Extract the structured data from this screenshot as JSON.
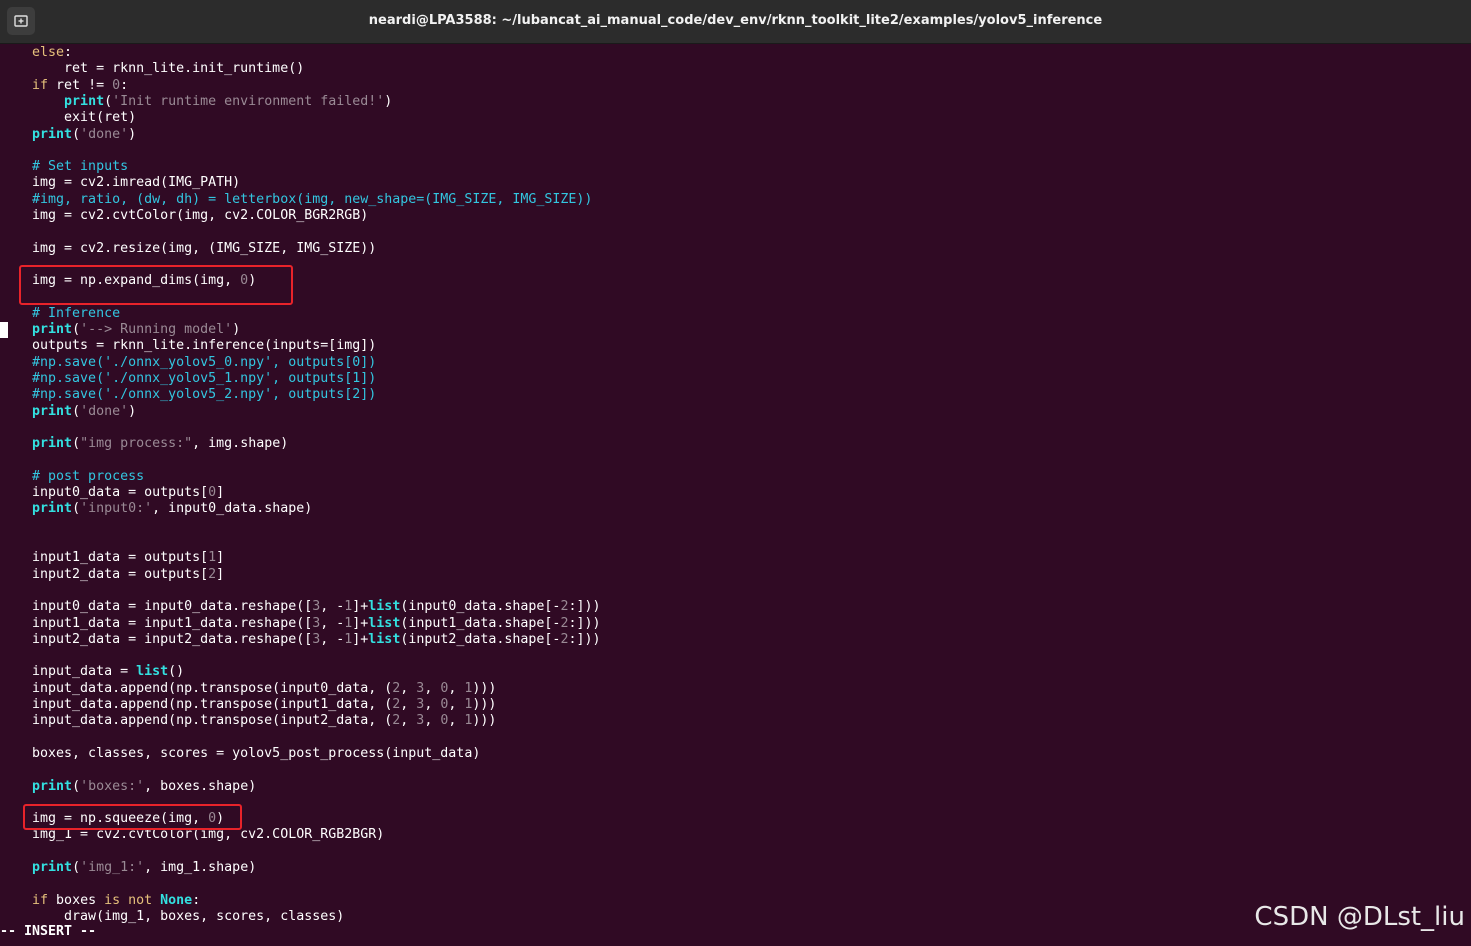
{
  "window": {
    "title": "neardi@LPA3588: ~/lubancat_ai_manual_code/dev_env/rknn_toolkit_lite2/examples/yolov5_inference",
    "new_tab_icon": "new-tab-icon"
  },
  "colors": {
    "background": "#300a24",
    "keyword": "#e5c07b",
    "builtin": "#33e0e0",
    "string": "#9a8a95",
    "comment": "#33c6e0",
    "highlight_box": "#e8232a"
  },
  "editor": {
    "lines": [
      [
        [
          "kw",
          "    else"
        ],
        [
          "tx",
          ":"
        ]
      ],
      [
        [
          "tx",
          "        ret = rknn_lite.init_runtime()"
        ]
      ],
      [
        [
          "kw",
          "    if"
        ],
        [
          "tx",
          " ret != "
        ],
        [
          "num",
          "0"
        ],
        [
          "tx",
          ":"
        ]
      ],
      [
        [
          "tx",
          "        "
        ],
        [
          "bi",
          "print"
        ],
        [
          "tx",
          "("
        ],
        [
          "str",
          "'Init runtime environment failed!'"
        ],
        [
          "tx",
          ")"
        ]
      ],
      [
        [
          "tx",
          "        exit(ret)"
        ]
      ],
      [
        [
          "tx",
          "    "
        ],
        [
          "bi",
          "print"
        ],
        [
          "tx",
          "("
        ],
        [
          "str",
          "'done'"
        ],
        [
          "tx",
          ")"
        ]
      ],
      [],
      [
        [
          "cm",
          "    # Set inputs"
        ]
      ],
      [
        [
          "tx",
          "    img = cv2.imread(IMG_PATH)"
        ]
      ],
      [
        [
          "cm",
          "    #img, ratio, (dw, dh) = letterbox(img, new_shape=(IMG_SIZE, IMG_SIZE))"
        ]
      ],
      [
        [
          "tx",
          "    img = cv2.cvtColor(img, cv2.COLOR_BGR2RGB)"
        ]
      ],
      [],
      [
        [
          "tx",
          "    img = cv2.resize(img, (IMG_SIZE, IMG_SIZE))"
        ]
      ],
      [],
      [
        [
          "tx",
          "    img = np.expand_dims(img, "
        ],
        [
          "num",
          "0"
        ],
        [
          "tx",
          ")"
        ]
      ],
      [],
      [
        [
          "cm",
          "    # Inference"
        ]
      ],
      [
        [
          "tx",
          "    "
        ],
        [
          "bi",
          "print"
        ],
        [
          "tx",
          "("
        ],
        [
          "str",
          "'--> Running model'"
        ],
        [
          "tx",
          ")"
        ]
      ],
      [
        [
          "tx",
          "    outputs = rknn_lite.inference(inputs=[img])"
        ]
      ],
      [
        [
          "cm",
          "    #np.save('./onnx_yolov5_0.npy', outputs[0])"
        ]
      ],
      [
        [
          "cm",
          "    #np.save('./onnx_yolov5_1.npy', outputs[1])"
        ]
      ],
      [
        [
          "cm",
          "    #np.save('./onnx_yolov5_2.npy', outputs[2])"
        ]
      ],
      [
        [
          "tx",
          "    "
        ],
        [
          "bi",
          "print"
        ],
        [
          "tx",
          "("
        ],
        [
          "str",
          "'done'"
        ],
        [
          "tx",
          ")"
        ]
      ],
      [],
      [
        [
          "tx",
          "    "
        ],
        [
          "bi",
          "print"
        ],
        [
          "tx",
          "("
        ],
        [
          "str",
          "\"img process:\""
        ],
        [
          "tx",
          ", img.shape)"
        ]
      ],
      [],
      [
        [
          "cm",
          "    # post process"
        ]
      ],
      [
        [
          "tx",
          "    input0_data = outputs["
        ],
        [
          "num",
          "0"
        ],
        [
          "tx",
          "]"
        ]
      ],
      [
        [
          "tx",
          "    "
        ],
        [
          "bi",
          "print"
        ],
        [
          "tx",
          "("
        ],
        [
          "str",
          "'input0:'"
        ],
        [
          "tx",
          ", input0_data.shape)"
        ]
      ],
      [],
      [],
      [
        [
          "tx",
          "    input1_data = outputs["
        ],
        [
          "num",
          "1"
        ],
        [
          "tx",
          "]"
        ]
      ],
      [
        [
          "tx",
          "    input2_data = outputs["
        ],
        [
          "num",
          "2"
        ],
        [
          "tx",
          "]"
        ]
      ],
      [],
      [
        [
          "tx",
          "    input0_data = input0_data.reshape(["
        ],
        [
          "num",
          "3"
        ],
        [
          "tx",
          ", -"
        ],
        [
          "num",
          "1"
        ],
        [
          "tx",
          "]+"
        ],
        [
          "bi",
          "list"
        ],
        [
          "tx",
          "(input0_data.shape[-"
        ],
        [
          "num",
          "2"
        ],
        [
          "tx",
          ":]))"
        ]
      ],
      [
        [
          "tx",
          "    input1_data = input1_data.reshape(["
        ],
        [
          "num",
          "3"
        ],
        [
          "tx",
          ", -"
        ],
        [
          "num",
          "1"
        ],
        [
          "tx",
          "]+"
        ],
        [
          "bi",
          "list"
        ],
        [
          "tx",
          "(input1_data.shape[-"
        ],
        [
          "num",
          "2"
        ],
        [
          "tx",
          ":]))"
        ]
      ],
      [
        [
          "tx",
          "    input2_data = input2_data.reshape(["
        ],
        [
          "num",
          "3"
        ],
        [
          "tx",
          ", -"
        ],
        [
          "num",
          "1"
        ],
        [
          "tx",
          "]+"
        ],
        [
          "bi",
          "list"
        ],
        [
          "tx",
          "(input2_data.shape[-"
        ],
        [
          "num",
          "2"
        ],
        [
          "tx",
          ":]))"
        ]
      ],
      [],
      [
        [
          "tx",
          "    input_data = "
        ],
        [
          "bi",
          "list"
        ],
        [
          "tx",
          "()"
        ]
      ],
      [
        [
          "tx",
          "    input_data.append(np.transpose(input0_data, ("
        ],
        [
          "num",
          "2"
        ],
        [
          "tx",
          ", "
        ],
        [
          "num",
          "3"
        ],
        [
          "tx",
          ", "
        ],
        [
          "num",
          "0"
        ],
        [
          "tx",
          ", "
        ],
        [
          "num",
          "1"
        ],
        [
          "tx",
          ")))"
        ]
      ],
      [
        [
          "tx",
          "    input_data.append(np.transpose(input1_data, ("
        ],
        [
          "num",
          "2"
        ],
        [
          "tx",
          ", "
        ],
        [
          "num",
          "3"
        ],
        [
          "tx",
          ", "
        ],
        [
          "num",
          "0"
        ],
        [
          "tx",
          ", "
        ],
        [
          "num",
          "1"
        ],
        [
          "tx",
          ")))"
        ]
      ],
      [
        [
          "tx",
          "    input_data.append(np.transpose(input2_data, ("
        ],
        [
          "num",
          "2"
        ],
        [
          "tx",
          ", "
        ],
        [
          "num",
          "3"
        ],
        [
          "tx",
          ", "
        ],
        [
          "num",
          "0"
        ],
        [
          "tx",
          ", "
        ],
        [
          "num",
          "1"
        ],
        [
          "tx",
          ")))"
        ]
      ],
      [],
      [
        [
          "tx",
          "    boxes, classes, scores = yolov5_post_process(input_data)"
        ]
      ],
      [],
      [
        [
          "tx",
          "    "
        ],
        [
          "bi",
          "print"
        ],
        [
          "tx",
          "("
        ],
        [
          "str",
          "'boxes:'"
        ],
        [
          "tx",
          ", boxes.shape)"
        ]
      ],
      [],
      [
        [
          "tx",
          "    img = np.squeeze(img, "
        ],
        [
          "num",
          "0"
        ],
        [
          "tx",
          ")"
        ]
      ],
      [
        [
          "tx",
          "    img_1 = cv2.cvtColor(img, cv2.COLOR_RGB2BGR)"
        ]
      ],
      [],
      [
        [
          "tx",
          "    "
        ],
        [
          "bi",
          "print"
        ],
        [
          "tx",
          "("
        ],
        [
          "str",
          "'img_1:'"
        ],
        [
          "tx",
          ", img_1.shape)"
        ]
      ],
      [],
      [
        [
          "kw",
          "    if"
        ],
        [
          "tx",
          " boxes "
        ],
        [
          "kw",
          "is not"
        ],
        [
          "tx",
          " "
        ],
        [
          "cn",
          "None"
        ],
        [
          "tx",
          ":"
        ]
      ],
      [
        [
          "tx",
          "        draw(img_1, boxes, scores, classes)"
        ]
      ]
    ],
    "mode_line": "-- INSERT --"
  },
  "watermark": "CSDN @DLst_liu"
}
